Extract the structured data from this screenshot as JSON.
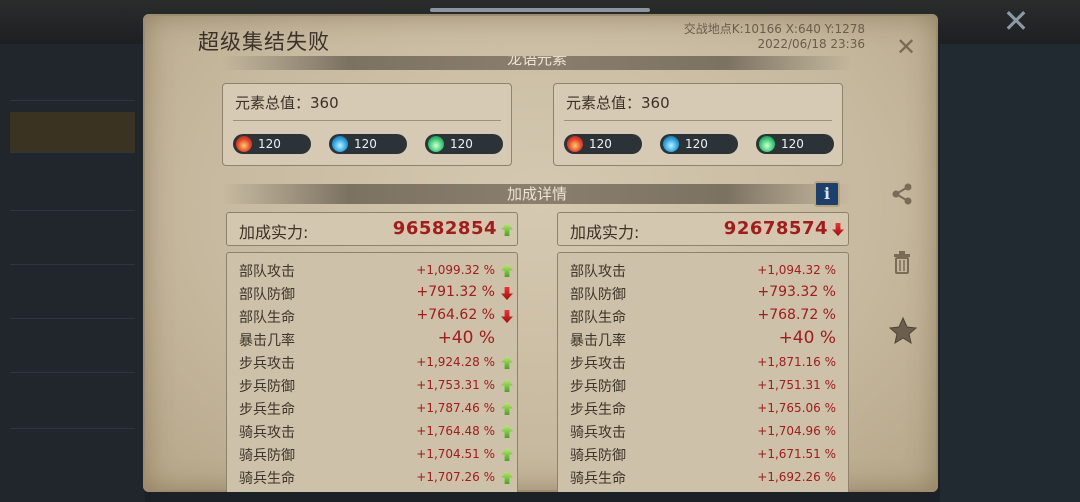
{
  "background": {
    "sidebar_items": [
      "",
      "",
      "",
      "",
      "",
      "",
      "",
      ""
    ],
    "close_label": "✕"
  },
  "dialog": {
    "title": "超级集结失败",
    "battle_location": "交战地点K:10166 X:640 Y:1278",
    "timestamp": "2022/06/18 23:36",
    "close_label": "✕",
    "element_banner": "龙语元素",
    "bonus_banner": "加成详情",
    "info_label": "i"
  },
  "left": {
    "element_total_label": "元素总值：360",
    "elements": [
      {
        "icon": "fire-icon",
        "value": "120"
      },
      {
        "icon": "water-icon",
        "value": "120"
      },
      {
        "icon": "wind-icon",
        "value": "120"
      }
    ],
    "power_label": "加成实力:",
    "power_value": "96582854",
    "power_trend": "up",
    "stats": [
      {
        "name": "部队攻击",
        "value": "+1,099.32 %",
        "trend": "up"
      },
      {
        "name": "部队防御",
        "value": "+791.32 %",
        "trend": "down"
      },
      {
        "name": "部队生命",
        "value": "+764.62 %",
        "trend": "down"
      },
      {
        "name": "暴击几率",
        "value": "+40 %",
        "trend": "none"
      },
      {
        "name": "步兵攻击",
        "value": "+1,924.28 %",
        "trend": "up"
      },
      {
        "name": "步兵防御",
        "value": "+1,753.31 %",
        "trend": "up"
      },
      {
        "name": "步兵生命",
        "value": "+1,787.46 %",
        "trend": "up"
      },
      {
        "name": "骑兵攻击",
        "value": "+1,764.48 %",
        "trend": "up"
      },
      {
        "name": "骑兵防御",
        "value": "+1,704.51 %",
        "trend": "up"
      },
      {
        "name": "骑兵生命",
        "value": "+1,707.26 %",
        "trend": "up"
      }
    ]
  },
  "right": {
    "element_total_label": "元素总值：360",
    "elements": [
      {
        "icon": "fire-icon",
        "value": "120"
      },
      {
        "icon": "water-icon",
        "value": "120"
      },
      {
        "icon": "wind-icon",
        "value": "120"
      }
    ],
    "power_label": "加成实力:",
    "power_value": "92678574",
    "power_trend": "down",
    "stats": [
      {
        "name": "部队攻击",
        "value": "+1,094.32 %"
      },
      {
        "name": "部队防御",
        "value": "+793.32 %"
      },
      {
        "name": "部队生命",
        "value": "+768.72 %"
      },
      {
        "name": "暴击几率",
        "value": "+40 %"
      },
      {
        "name": "步兵攻击",
        "value": "+1,871.16 %"
      },
      {
        "name": "步兵防御",
        "value": "+1,751.31 %"
      },
      {
        "name": "步兵生命",
        "value": "+1,765.06 %"
      },
      {
        "name": "骑兵攻击",
        "value": "+1,704.96 %"
      },
      {
        "name": "骑兵防御",
        "value": "+1,671.51 %"
      },
      {
        "name": "骑兵生命",
        "value": "+1,692.26 %"
      }
    ]
  },
  "side_actions": {
    "share_icon": "share-icon",
    "delete_icon": "trash-icon",
    "favorite_icon": "star-icon"
  }
}
